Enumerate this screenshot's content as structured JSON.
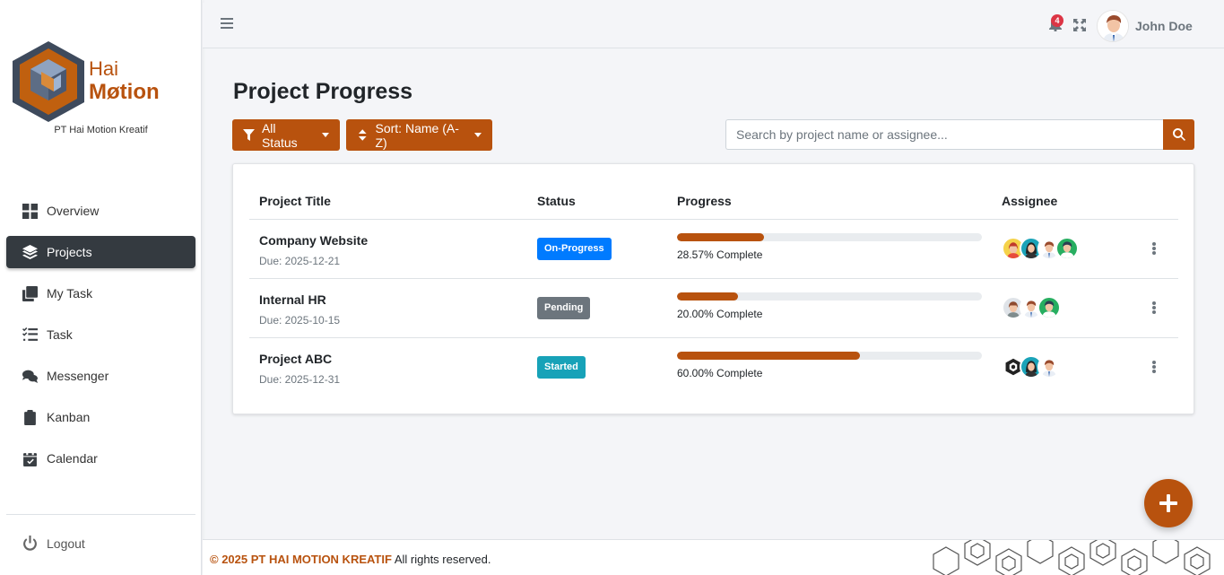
{
  "brand": {
    "logo_line1": "Hai",
    "logo_line2": "Møtion",
    "company": "PT Hai Motion Kreatif",
    "color": "#b8520e"
  },
  "sidebar": {
    "items": [
      {
        "label": "Overview",
        "icon": "grid-icon"
      },
      {
        "label": "Projects",
        "icon": "layers-icon",
        "active": true
      },
      {
        "label": "My Task",
        "icon": "copy-icon"
      },
      {
        "label": "Task",
        "icon": "checklist-icon"
      },
      {
        "label": "Messenger",
        "icon": "comments-icon"
      },
      {
        "label": "Kanban",
        "icon": "clipboard-icon"
      },
      {
        "label": "Calendar",
        "icon": "calendar-check-icon"
      }
    ],
    "logout": "Logout"
  },
  "topbar": {
    "notification_count": "4",
    "user_name": "John Doe"
  },
  "page": {
    "title": "Project Progress",
    "filter_label": "All Status",
    "sort_label": "Sort: Name (A-Z)",
    "search_placeholder": "Search by project name or assignee..."
  },
  "table": {
    "headers": {
      "title": "Project Title",
      "status": "Status",
      "progress": "Progress",
      "assignee": "Assignee"
    },
    "rows": [
      {
        "title": "Company Website",
        "due": "Due: 2025-12-21",
        "status": "On-Progress",
        "status_color": "#007bff",
        "progress": 28.57,
        "progress_text": "28.57% Complete",
        "assignees": [
          "woman-avatar",
          "woman-teal-avatar",
          "man-tie-avatar",
          "man-green-avatar"
        ]
      },
      {
        "title": "Internal HR",
        "due": "Due: 2025-10-15",
        "status": "Pending",
        "status_color": "#6c757d",
        "progress": 20.0,
        "progress_text": "20.00% Complete",
        "assignees": [
          "woman-grey-avatar",
          "man-tie-avatar",
          "man-green-avatar"
        ]
      },
      {
        "title": "Project ABC",
        "due": "Due: 2025-12-31",
        "status": "Started",
        "status_color": "#17a2b8",
        "progress": 60.0,
        "progress_text": "60.00% Complete",
        "assignees": [
          "hexagon-logo-avatar",
          "woman-teal-avatar",
          "man-tie-avatar"
        ]
      }
    ]
  },
  "footer": {
    "brand": "© 2025 PT HAI MOTION KREATIF",
    "rest": "All rights reserved."
  }
}
